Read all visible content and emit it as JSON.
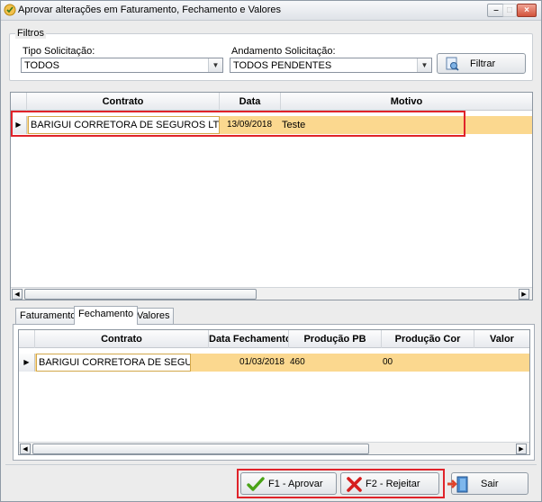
{
  "window": {
    "title": "Aprovar alterações em Faturamento, Fechamento e Valores",
    "icon": "approval-app-icon"
  },
  "filters": {
    "legend": "Filtros",
    "tipo_label": "Tipo Solicitação:",
    "tipo_value": "TODOS",
    "andamento_label": "Andamento Solicitação:",
    "andamento_value": "TODOS PENDENTES",
    "filter_button": "Filtrar"
  },
  "requests_grid": {
    "columns": [
      "Contrato",
      "Data",
      "Motivo"
    ],
    "rows": [
      {
        "contrato": "BARIGUI CORRETORA DE SEGUROS LTDA...",
        "data": "13/09/2018",
        "motivo": "Teste"
      }
    ]
  },
  "tabs": [
    {
      "label": "Faturamento"
    },
    {
      "label": "Fechamento"
    },
    {
      "label": "Valores"
    }
  ],
  "active_tab": "Fechamento",
  "closing_grid": {
    "columns": [
      "Contrato",
      "Data Fechamento",
      "Produção PB",
      "Produção Cor",
      "Valor"
    ],
    "rows": [
      {
        "contrato": "BARIGUI CORRETORA DE SEGUR...",
        "data_fechamento": "01/03/2018",
        "producao_pb": "460",
        "producao_cor": "00",
        "valor": ""
      }
    ]
  },
  "actions": {
    "approve": "F1 - Aprovar",
    "reject": "F2 - Rejeitar",
    "exit": "Sair"
  },
  "colors": {
    "selected_row": "#fbd88f",
    "highlight_border": "#e0232a"
  }
}
